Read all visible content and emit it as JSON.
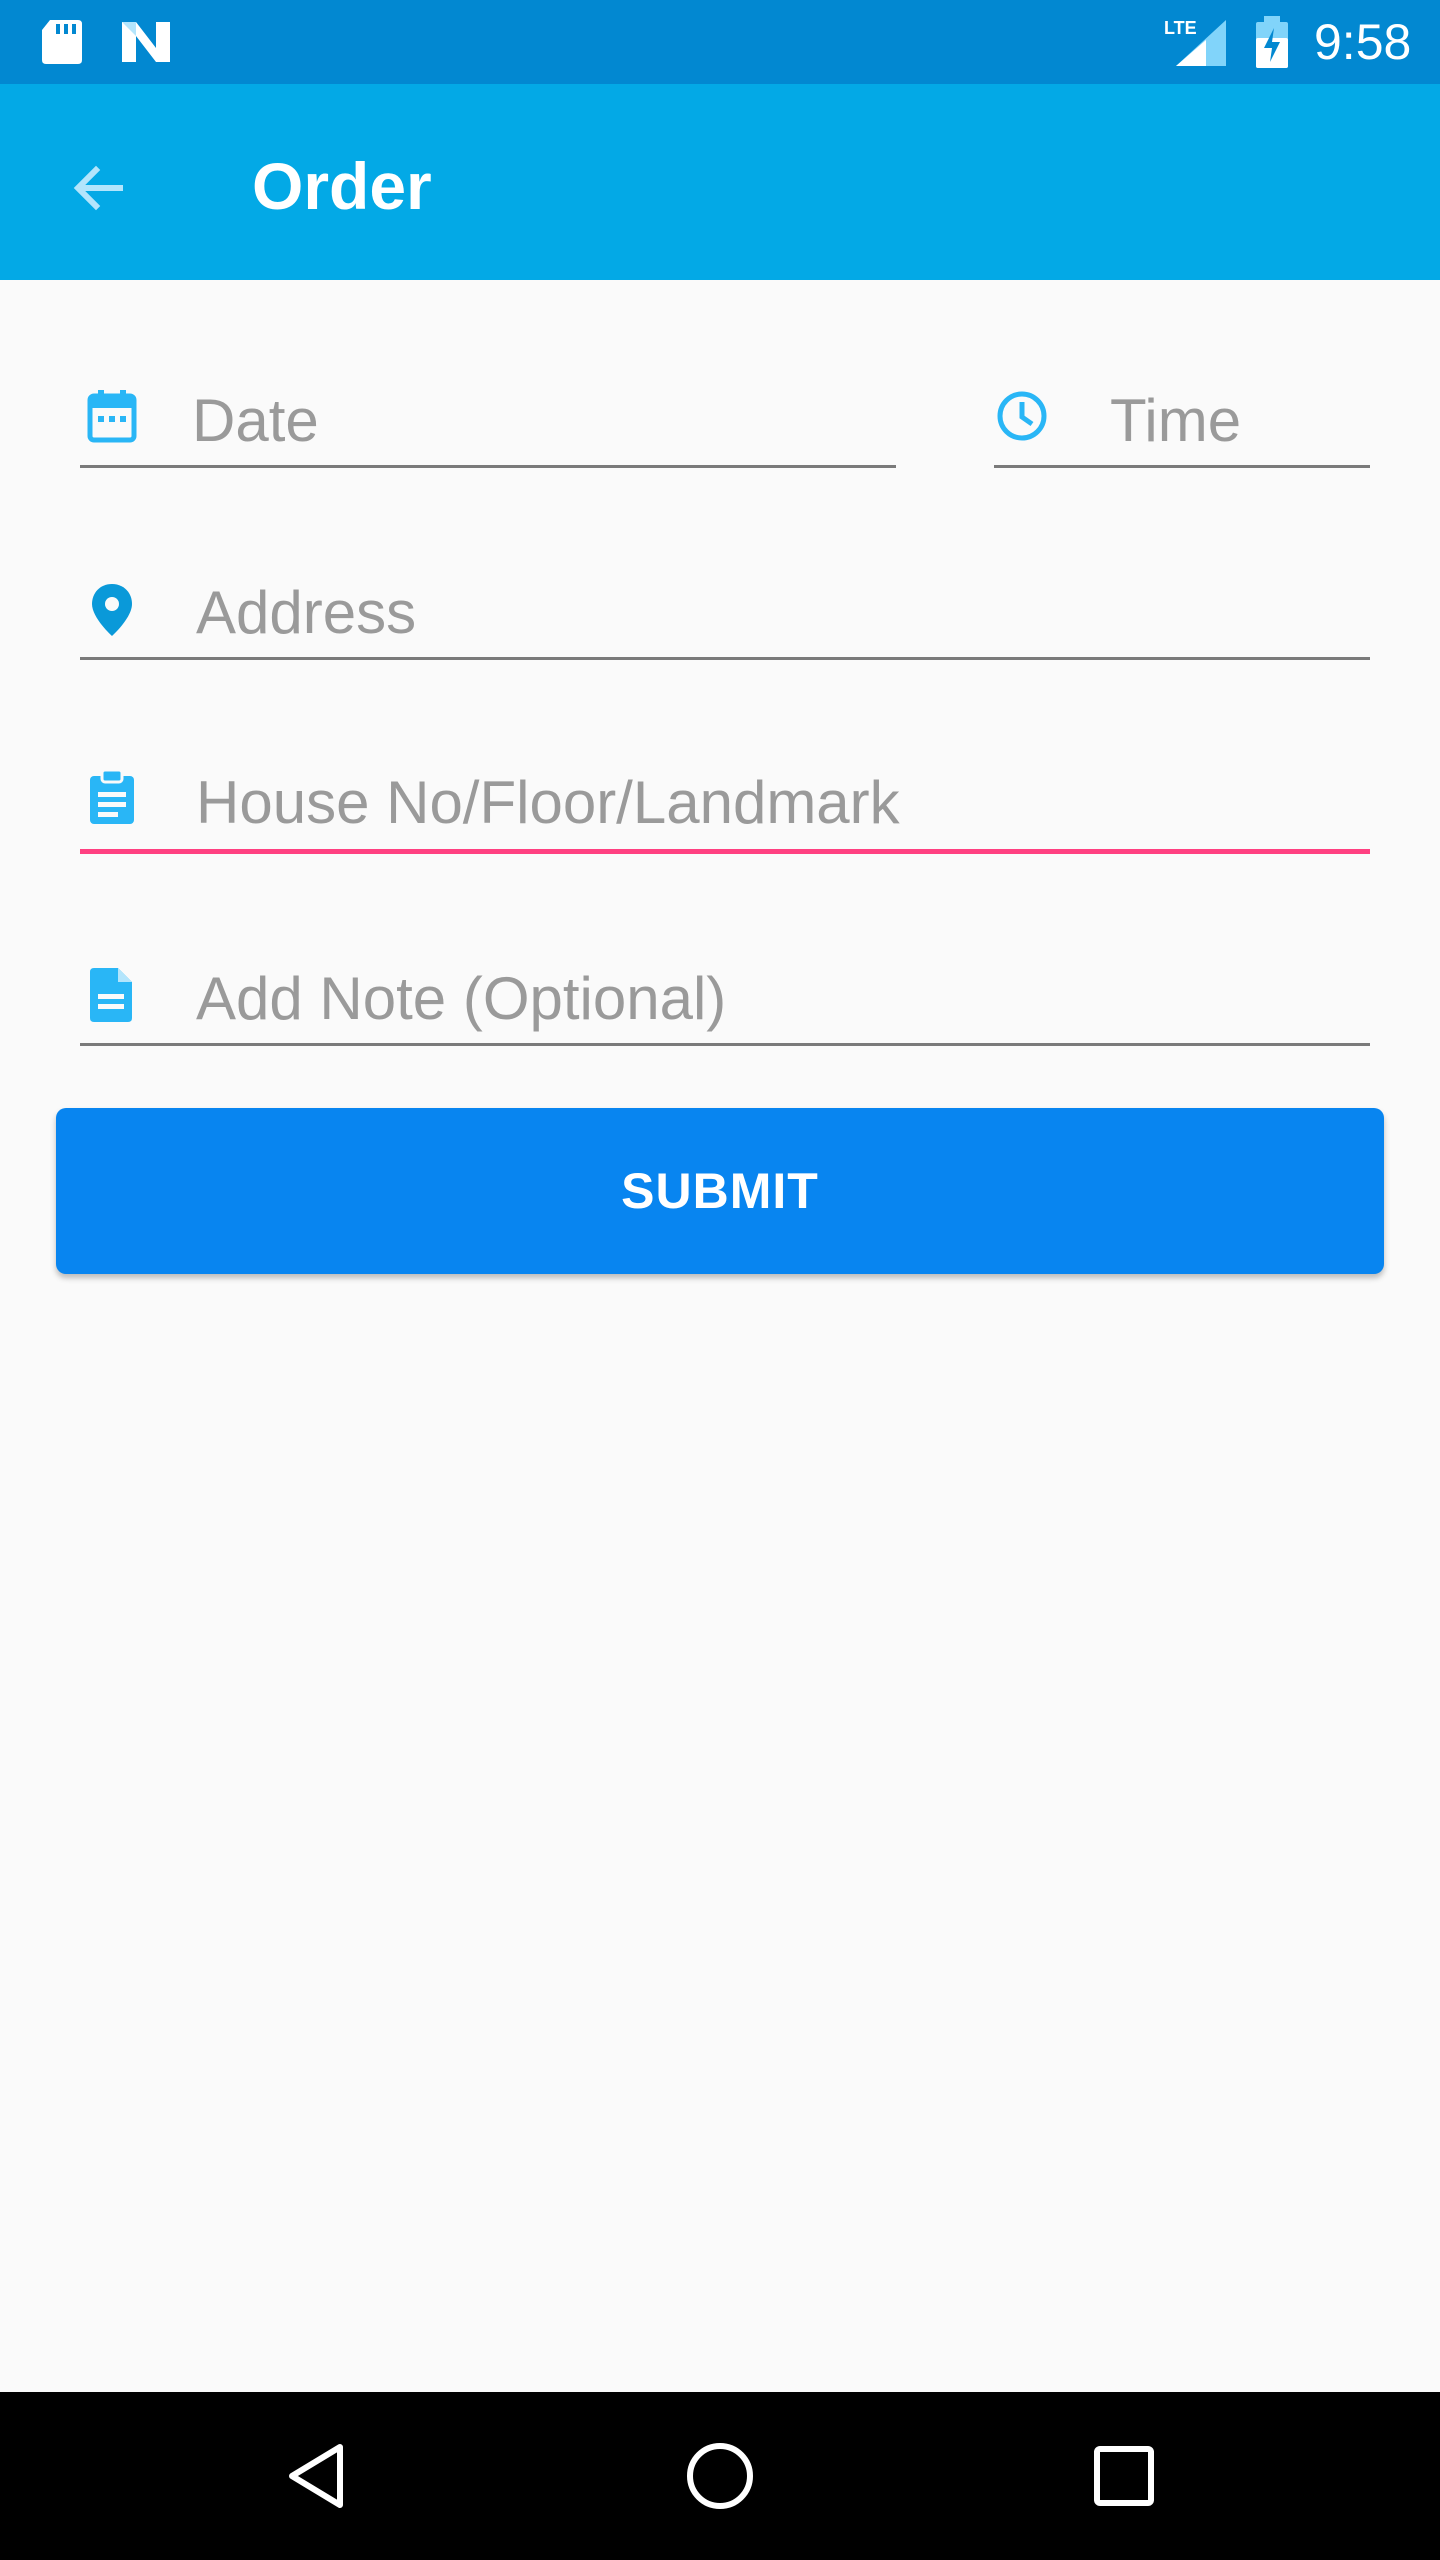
{
  "status_bar": {
    "network": "LTE",
    "time": "9:58",
    "icons": [
      "sd-card-icon",
      "n-notification-icon",
      "lte-signal-icon",
      "battery-charging-icon"
    ]
  },
  "app_bar": {
    "title": "Order",
    "back_icon": "arrow-back-icon",
    "background_color": "#03a9e6"
  },
  "form": {
    "date": {
      "placeholder": "Date",
      "value": "",
      "icon": "calendar-icon"
    },
    "time": {
      "placeholder": "Time",
      "value": "",
      "icon": "clock-icon"
    },
    "address": {
      "placeholder": "Address",
      "value": "",
      "icon": "location-pin-icon"
    },
    "house": {
      "placeholder": "House No/Floor/Landmark",
      "value": "",
      "icon": "clipboard-icon",
      "focused": true
    },
    "note": {
      "placeholder": "Add Note (Optional)",
      "value": "",
      "icon": "document-icon"
    },
    "submit_label": "SUBMIT"
  },
  "colors": {
    "accent": "#ff4081",
    "icon_blue": "#29b6f6",
    "button": "#0885f0",
    "status_bar": "#0288d1"
  },
  "nav_bar": {
    "buttons": [
      "back-triangle-icon",
      "home-circle-icon",
      "recents-square-icon"
    ]
  }
}
